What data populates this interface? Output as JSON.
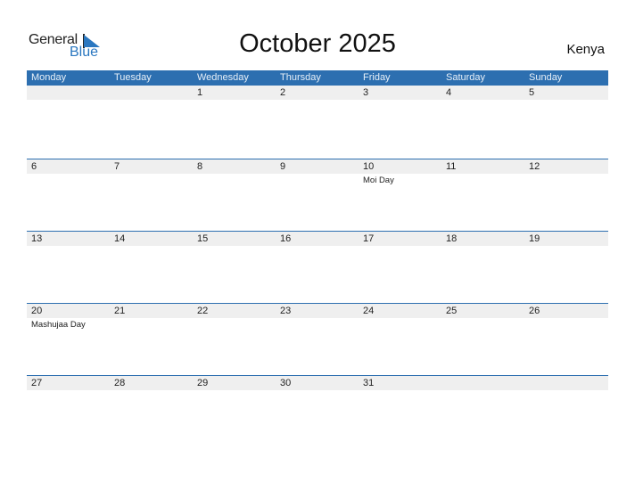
{
  "logo": {
    "word1": "General",
    "word2": "Blue",
    "color": "#2a77c0"
  },
  "title": "October 2025",
  "country": "Kenya",
  "colors": {
    "header_bg": "#2d6fb0",
    "strip_bg": "#efefef"
  },
  "weekdays": [
    "Monday",
    "Tuesday",
    "Wednesday",
    "Thursday",
    "Friday",
    "Saturday",
    "Sunday"
  ],
  "weeks": [
    {
      "days": [
        {
          "n": "",
          "h": ""
        },
        {
          "n": "",
          "h": ""
        },
        {
          "n": "1",
          "h": ""
        },
        {
          "n": "2",
          "h": ""
        },
        {
          "n": "3",
          "h": ""
        },
        {
          "n": "4",
          "h": ""
        },
        {
          "n": "5",
          "h": ""
        }
      ]
    },
    {
      "days": [
        {
          "n": "6",
          "h": ""
        },
        {
          "n": "7",
          "h": ""
        },
        {
          "n": "8",
          "h": ""
        },
        {
          "n": "9",
          "h": ""
        },
        {
          "n": "10",
          "h": "Moi Day"
        },
        {
          "n": "11",
          "h": ""
        },
        {
          "n": "12",
          "h": ""
        }
      ]
    },
    {
      "days": [
        {
          "n": "13",
          "h": ""
        },
        {
          "n": "14",
          "h": ""
        },
        {
          "n": "15",
          "h": ""
        },
        {
          "n": "16",
          "h": ""
        },
        {
          "n": "17",
          "h": ""
        },
        {
          "n": "18",
          "h": ""
        },
        {
          "n": "19",
          "h": ""
        }
      ]
    },
    {
      "days": [
        {
          "n": "20",
          "h": "Mashujaa Day"
        },
        {
          "n": "21",
          "h": ""
        },
        {
          "n": "22",
          "h": ""
        },
        {
          "n": "23",
          "h": ""
        },
        {
          "n": "24",
          "h": ""
        },
        {
          "n": "25",
          "h": ""
        },
        {
          "n": "26",
          "h": ""
        }
      ]
    },
    {
      "days": [
        {
          "n": "27",
          "h": ""
        },
        {
          "n": "28",
          "h": ""
        },
        {
          "n": "29",
          "h": ""
        },
        {
          "n": "30",
          "h": ""
        },
        {
          "n": "31",
          "h": ""
        },
        {
          "n": "",
          "h": ""
        },
        {
          "n": "",
          "h": ""
        }
      ]
    }
  ]
}
